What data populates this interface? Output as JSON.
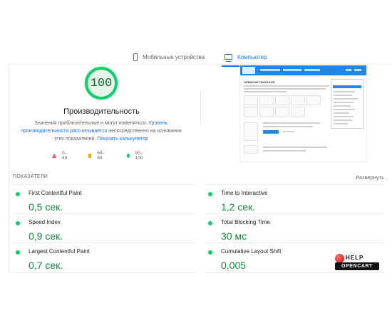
{
  "tabs": {
    "mobile": {
      "label": "Мобильные устройства",
      "icon": "smartphone-icon"
    },
    "desktop": {
      "label": "Компьютер",
      "icon": "monitor-icon"
    }
  },
  "summary": {
    "score": "100",
    "score_fraction": 1.0,
    "title": "Производительность",
    "desc_part1": "Значения приблизительные и могут изменяться. ",
    "desc_link1": "Уровень производительности рассчитывается",
    "desc_part2": " непосредственно на основании этих показателей. ",
    "desc_link2": "Показать калькулятор",
    "legend": [
      {
        "range": "0–49",
        "shape": "triangle",
        "color": "#ff4e42"
      },
      {
        "range": "50–89",
        "shape": "square",
        "color": "#ffa400"
      },
      {
        "range": "90–100",
        "shape": "circle",
        "color": "#0cce6b"
      }
    ]
  },
  "metrics": {
    "header": "ПОКАЗАТЕЛИ",
    "expand_label": "Развернуть",
    "items": [
      {
        "label": "First Contentful Paint",
        "value": "0,5 сек."
      },
      {
        "label": "Time to Interactive",
        "value": "1,2 сек."
      },
      {
        "label": "Speed Index",
        "value": "0,9 сек."
      },
      {
        "label": "Total Blocking Time",
        "value": "30 мс"
      },
      {
        "label": "Largest Contentful Paint",
        "value": "0,7 сек."
      },
      {
        "label": "Cumulative Layout Shift",
        "value": "0,005"
      }
    ]
  },
  "screenshot_preview": {
    "heading": "OPENCART MODULES"
  },
  "watermark": {
    "line1": "HELP",
    "line2": "OPENCART"
  },
  "colors": {
    "accent": "#1a73e8",
    "pass": "#0cce6b",
    "pass_text": "#0d8a3a"
  }
}
